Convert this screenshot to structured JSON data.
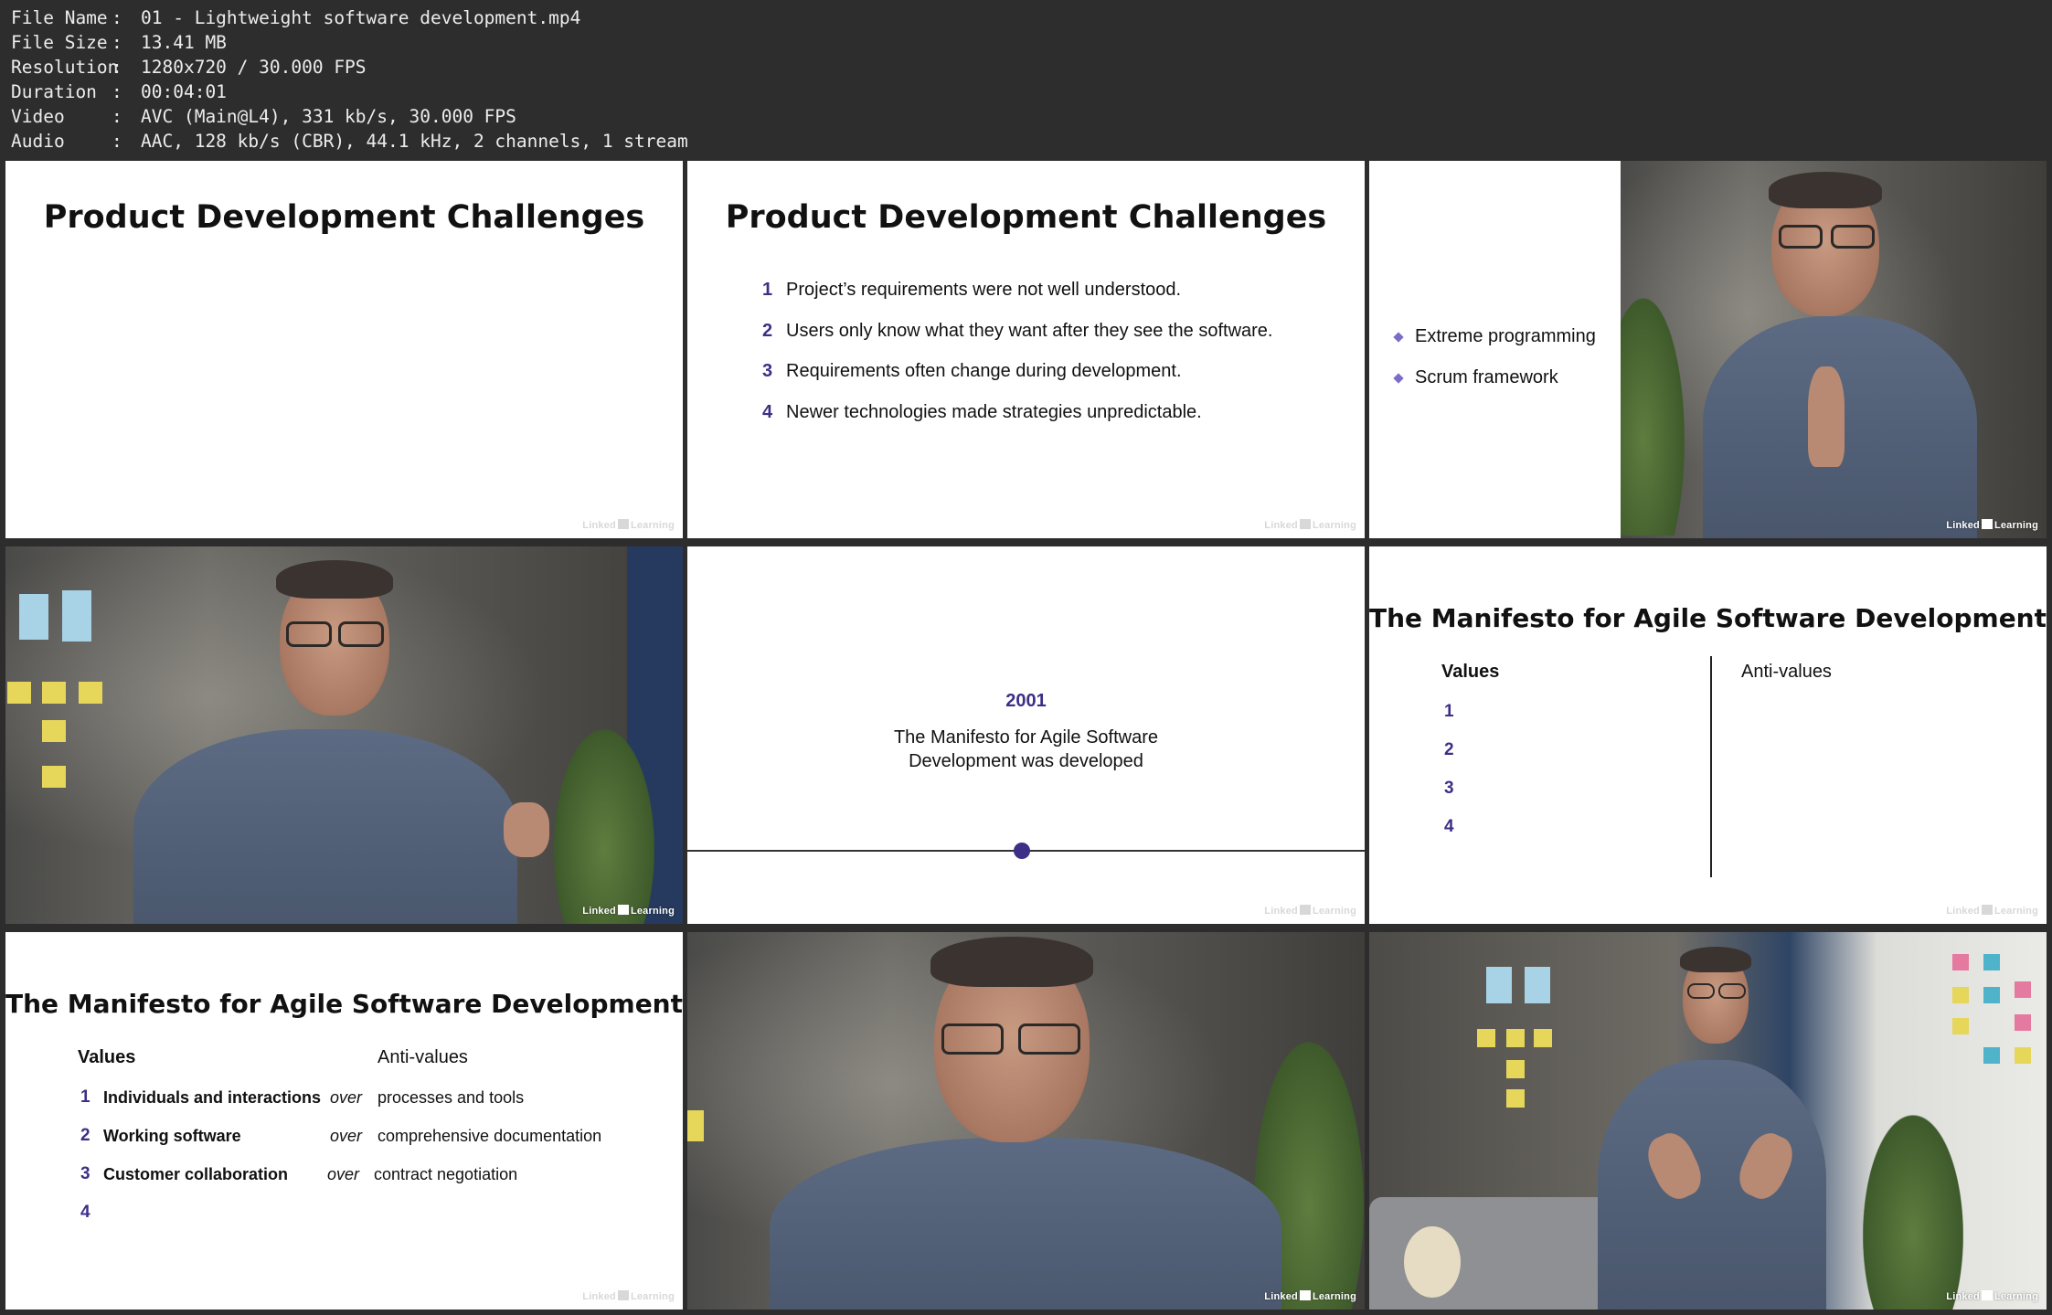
{
  "info": [
    {
      "key": "File Name",
      "value": "01 - Lightweight software development.mp4"
    },
    {
      "key": "File Size",
      "value": "13.41 MB"
    },
    {
      "key": "Resolution",
      "value": "1280x720 / 30.000 FPS"
    },
    {
      "key": "Duration",
      "value": "00:04:01"
    },
    {
      "key": "Video",
      "value": "AVC (Main@L4), 331 kb/s, 30.000 FPS"
    },
    {
      "key": "Audio",
      "value": "AAC, 128 kb/s (CBR), 44.1 kHz, 2 channels, 1 stream"
    }
  ],
  "separator": ":",
  "watermark": {
    "prefix": "Linked",
    "badge": "in",
    "suffix": "Learning"
  },
  "slide_challenges": {
    "title": "Product Development Challenges",
    "items": [
      {
        "num": "1",
        "text": "Project’s requirements were not well understood."
      },
      {
        "num": "2",
        "text": "Users only know what they want after they see the software."
      },
      {
        "num": "3",
        "text": "Requirements often change during development."
      },
      {
        "num": "4",
        "text": "Newer technologies made strategies unpredictable."
      }
    ]
  },
  "slide_bullets": {
    "items": [
      "Extreme programming",
      "Scrum framework"
    ]
  },
  "slide_timeline": {
    "year": "2001",
    "line1": "The Manifesto for Agile Software",
    "line2": "Development was developed"
  },
  "slide_manifesto": {
    "title": "The Manifesto for Agile Software Development",
    "values_label": "Values",
    "anti_label": "Anti-values",
    "nums": [
      "1",
      "2",
      "3",
      "4"
    ],
    "rows": [
      {
        "value": "Individuals and interactions",
        "over": "over",
        "anti": "processes and tools"
      },
      {
        "value": "Working software",
        "over": "over",
        "anti": "comprehensive documentation"
      },
      {
        "value": "Customer collaboration",
        "over": "over",
        "anti": "contract negotiation"
      }
    ]
  },
  "colors": {
    "accent": "#3d2e86",
    "bullet": "#7b6cc7",
    "background": "#2d2d2d"
  }
}
